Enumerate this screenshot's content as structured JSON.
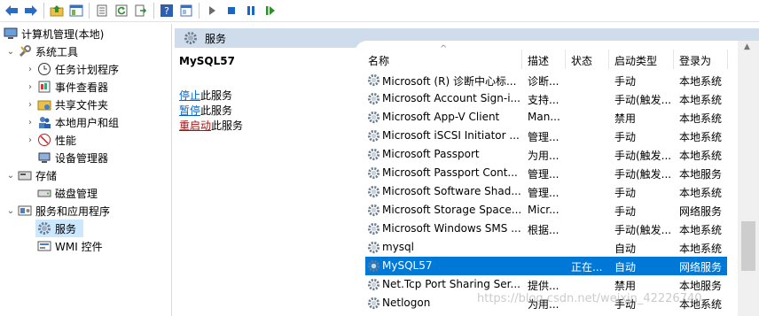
{
  "toolbar": {
    "buttons": [
      "back-icon",
      "forward-icon",
      "up-folder-icon",
      "show-hide-tree-icon",
      "export-list-icon",
      "refresh-icon",
      "export-icon",
      "help-icon",
      "properties-icon",
      "start-icon",
      "stop-icon",
      "pause-icon",
      "resume-icon"
    ]
  },
  "tree": {
    "items": [
      {
        "label": "计算机管理(本地)"
      },
      {
        "label": "系统工具"
      },
      {
        "label": "任务计划程序"
      },
      {
        "label": "事件查看器"
      },
      {
        "label": "共享文件夹"
      },
      {
        "label": "本地用户和组"
      },
      {
        "label": "性能"
      },
      {
        "label": "设备管理器"
      },
      {
        "label": "存储"
      },
      {
        "label": "磁盘管理"
      },
      {
        "label": "服务和应用程序"
      },
      {
        "label": "服务"
      },
      {
        "label": "WMI 控件"
      }
    ]
  },
  "header": {
    "title": "服务"
  },
  "detail": {
    "service_name": "MySQL57",
    "stop_link": "停止",
    "stop_suffix": "此服务",
    "pause_link": "暂停",
    "pause_suffix": "此服务",
    "restart_link": "重启动",
    "restart_suffix": "此服务"
  },
  "table": {
    "columns": [
      "名称",
      "描述",
      "状态",
      "启动类型",
      "登录为"
    ],
    "rows": [
      {
        "name": "Microsoft (R) 诊断中心标...",
        "desc": "诊断...",
        "state": "",
        "start": "手动",
        "logon": "本地系统"
      },
      {
        "name": "Microsoft Account Sign-i...",
        "desc": "支持...",
        "state": "",
        "start": "手动(触发...",
        "logon": "本地系统"
      },
      {
        "name": "Microsoft App-V Client",
        "desc": "Man...",
        "state": "",
        "start": "禁用",
        "logon": "本地系统"
      },
      {
        "name": "Microsoft iSCSI Initiator ...",
        "desc": "管理...",
        "state": "",
        "start": "手动",
        "logon": "本地系统"
      },
      {
        "name": "Microsoft Passport",
        "desc": "为用...",
        "state": "",
        "start": "手动(触发...",
        "logon": "本地系统"
      },
      {
        "name": "Microsoft Passport Cont...",
        "desc": "管理...",
        "state": "",
        "start": "手动(触发...",
        "logon": "本地服务"
      },
      {
        "name": "Microsoft Software Shad...",
        "desc": "管理...",
        "state": "",
        "start": "手动",
        "logon": "本地系统"
      },
      {
        "name": "Microsoft Storage Space...",
        "desc": "Micr...",
        "state": "",
        "start": "手动",
        "logon": "网络服务"
      },
      {
        "name": "Microsoft Windows SMS ...",
        "desc": "根据...",
        "state": "",
        "start": "手动(触发...",
        "logon": "本地系统"
      },
      {
        "name": "mysql",
        "desc": "",
        "state": "",
        "start": "自动",
        "logon": "本地系统"
      },
      {
        "name": "MySQL57",
        "desc": "",
        "state": "正在...",
        "start": "自动",
        "logon": "网络服务"
      },
      {
        "name": "Net.Tcp Port Sharing Ser...",
        "desc": "提供...",
        "state": "",
        "start": "禁用",
        "logon": "本地服务"
      },
      {
        "name": "Netlogon",
        "desc": "为用...",
        "state": "",
        "start": "手动",
        "logon": "本地系统"
      }
    ]
  },
  "watermark": "https://blog.csdn.net/weixin_42226740",
  "colors": {
    "selection": "#0078d7",
    "tree_selection": "#cce8ff",
    "header_band": "#cfdcec"
  }
}
